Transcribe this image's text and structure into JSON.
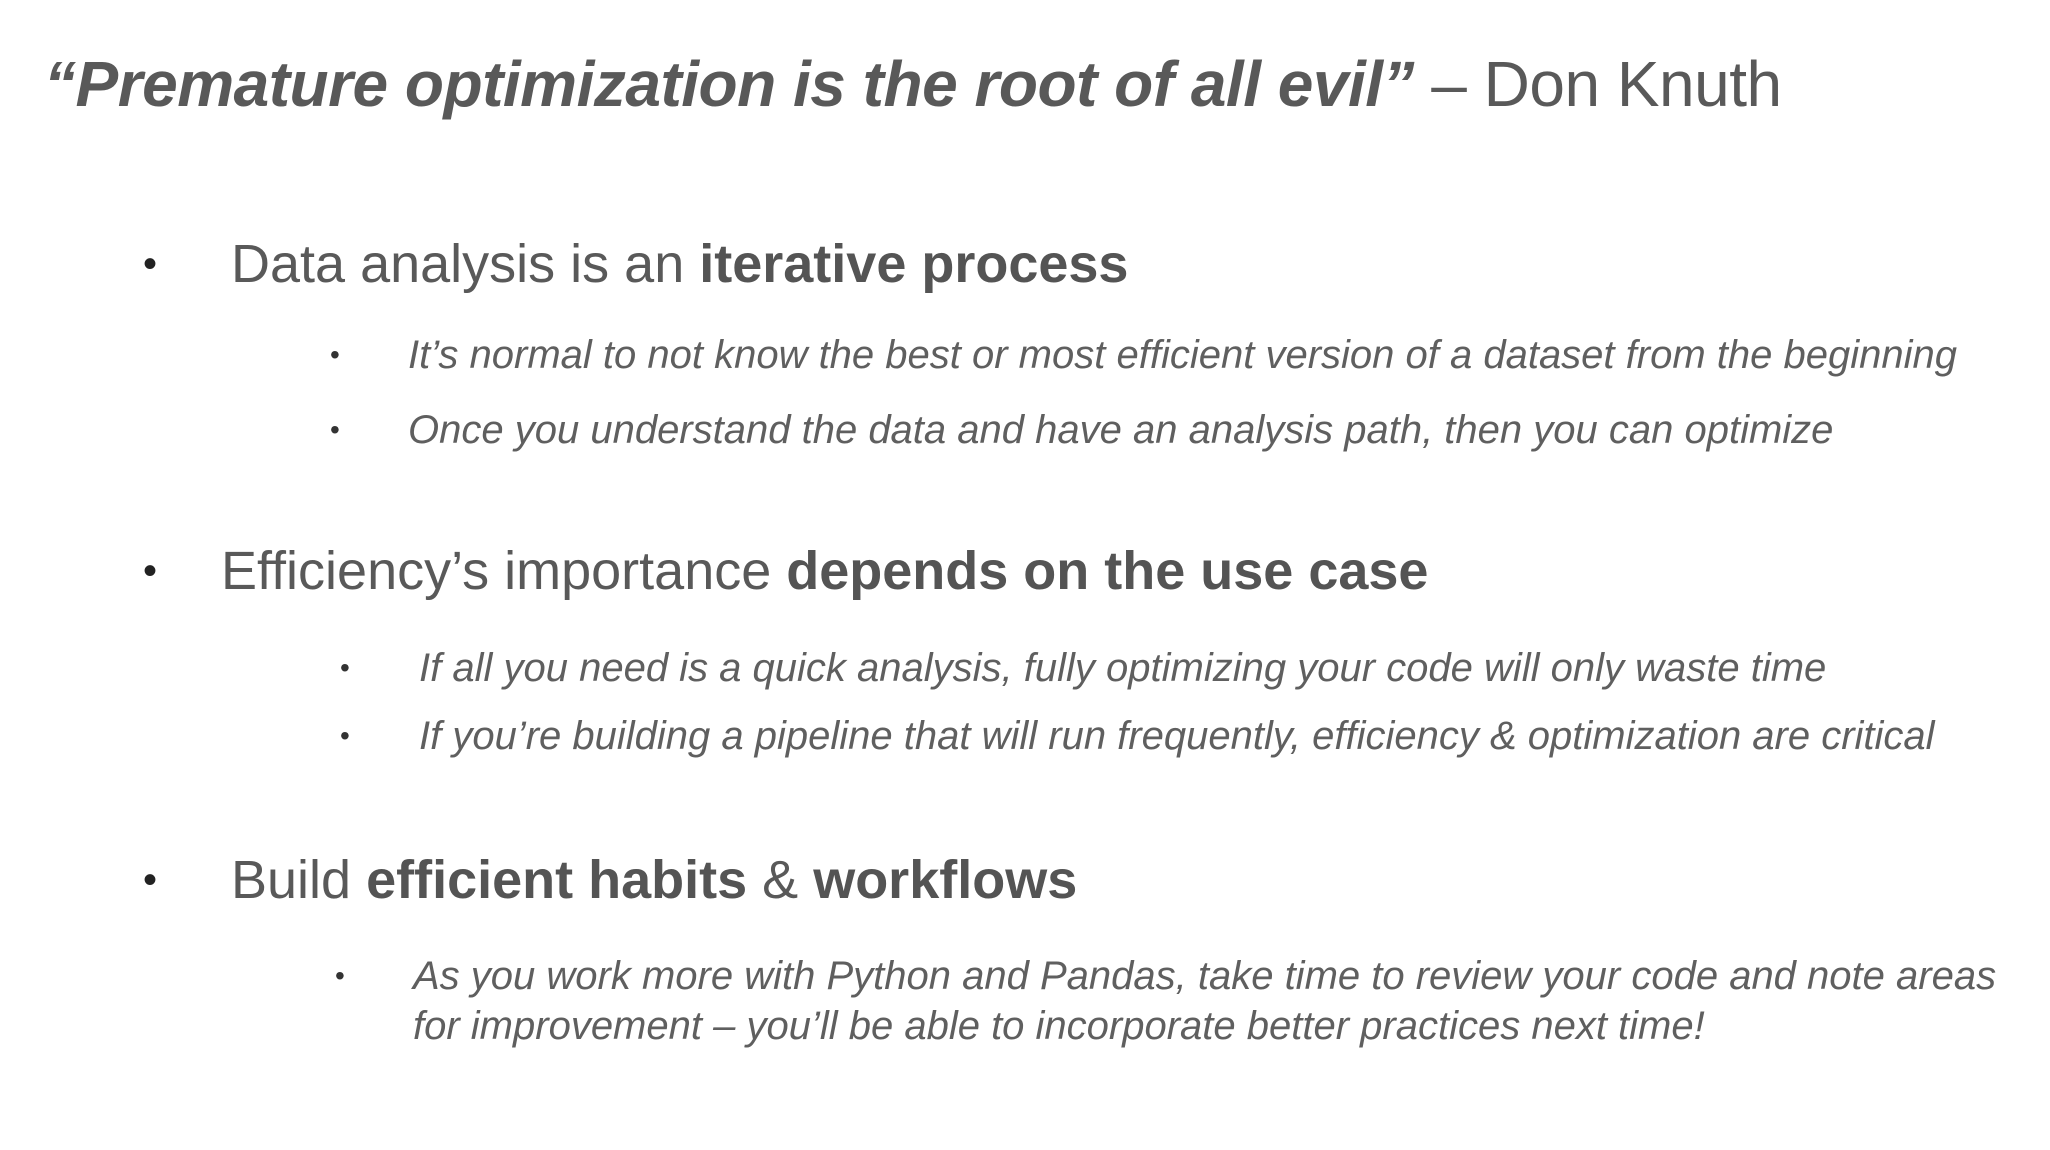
{
  "title": {
    "quote": "“Premature optimization is the root of all evil”",
    "attribution": " – Don Knuth"
  },
  "bullet_glyph": "•",
  "sections": [
    {
      "parts": [
        {
          "text": "Data analysis is an "
        },
        {
          "text": "iterative process",
          "bold": true
        }
      ],
      "sub": [
        [
          "It’s normal to not know the best or most efficient version of a dataset from the beginning"
        ],
        [
          "Once you understand the data and have an analysis path, then you can optimize"
        ]
      ]
    },
    {
      "parts": [
        {
          "text": "Efficiency’s importance "
        },
        {
          "text": "depends on the use case",
          "bold": true
        }
      ],
      "sub": [
        [
          "If all you need is a quick analysis, fully optimizing your code will only waste time"
        ],
        [
          "If you’re building a pipeline that will run frequently, efficiency & optimization are critical"
        ]
      ]
    },
    {
      "parts": [
        {
          "text": "Build "
        },
        {
          "text": "efficient habits",
          "bold": true
        },
        {
          "text": " & "
        },
        {
          "text": "workflows",
          "bold": true
        }
      ],
      "sub": [
        [
          "As you work more with Python and Pandas, take time to review your code and note areas",
          "for improvement – you’ll be able to incorporate better practices next time!"
        ]
      ]
    }
  ]
}
